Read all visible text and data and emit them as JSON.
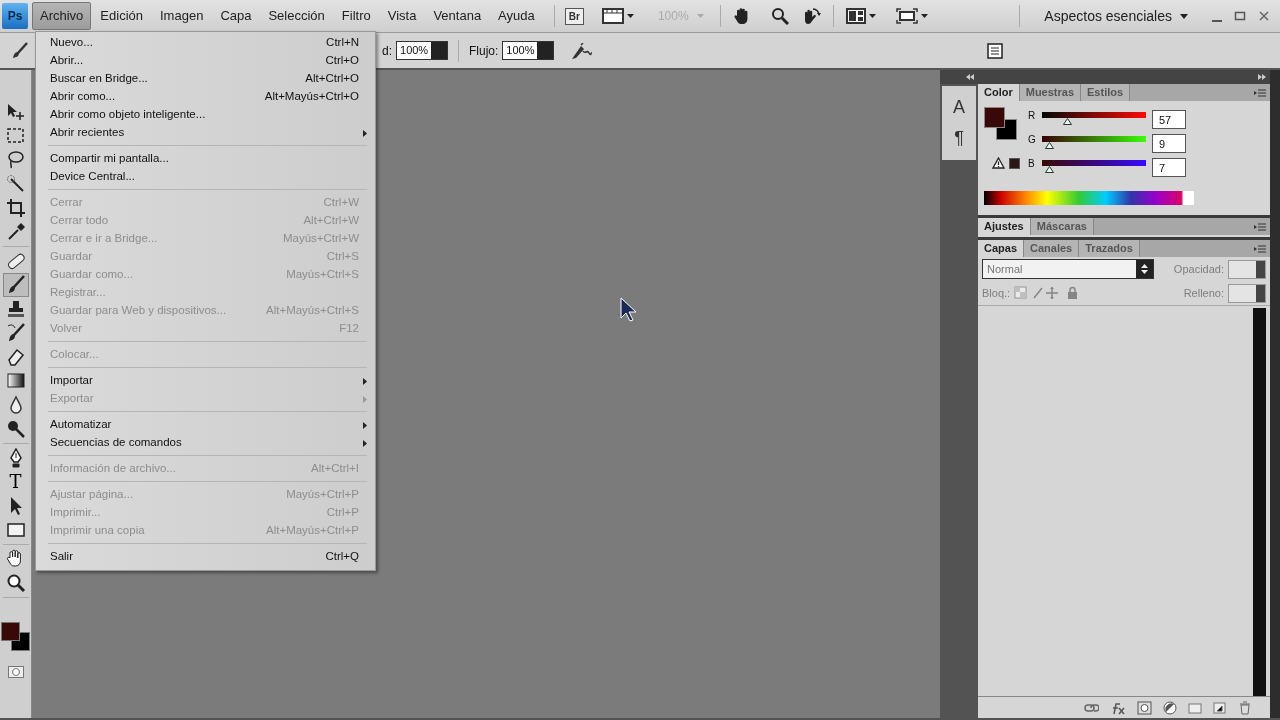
{
  "app_logo": "Ps",
  "menubar": {
    "menus": [
      {
        "label": "Archivo",
        "selected": true
      },
      {
        "label": "Edición",
        "selected": false
      },
      {
        "label": "Imagen",
        "selected": false
      },
      {
        "label": "Capa",
        "selected": false
      },
      {
        "label": "Selección",
        "selected": false
      },
      {
        "label": "Filtro",
        "selected": false
      },
      {
        "label": "Vista",
        "selected": false
      },
      {
        "label": "Ventana",
        "selected": false
      },
      {
        "label": "Ayuda",
        "selected": false
      }
    ],
    "bridge_label": "Br",
    "zoom": {
      "value": "100%",
      "disabled": true
    },
    "workspace": "Aspectos esenciales"
  },
  "options_bar": {
    "opacity_label": "d:",
    "opacity": "100%",
    "flow_label": "Flujo:",
    "flow": "100%"
  },
  "file_menu": {
    "items": [
      {
        "kind": "item",
        "label": "Nuevo...",
        "shortcut": "Ctrl+N",
        "disabled": false,
        "submenu": false
      },
      {
        "kind": "item",
        "label": "Abrir...",
        "shortcut": "Ctrl+O",
        "disabled": false,
        "submenu": false
      },
      {
        "kind": "item",
        "label": "Buscar en Bridge...",
        "shortcut": "Alt+Ctrl+O",
        "disabled": false,
        "submenu": false
      },
      {
        "kind": "item",
        "label": "Abrir como...",
        "shortcut": "Alt+Mayús+Ctrl+O",
        "disabled": false,
        "submenu": false
      },
      {
        "kind": "item",
        "label": "Abrir como objeto inteligente...",
        "disabled": false,
        "submenu": false
      },
      {
        "kind": "item",
        "label": "Abrir recientes",
        "disabled": false,
        "submenu": true
      },
      {
        "kind": "separator"
      },
      {
        "kind": "item",
        "label": "Compartir mi pantalla...",
        "disabled": false,
        "submenu": false
      },
      {
        "kind": "item",
        "label": "Device Central...",
        "disabled": false,
        "submenu": false
      },
      {
        "kind": "separator"
      },
      {
        "kind": "item",
        "label": "Cerrar",
        "shortcut": "Ctrl+W",
        "disabled": true,
        "submenu": false
      },
      {
        "kind": "item",
        "label": "Cerrar todo",
        "shortcut": "Alt+Ctrl+W",
        "disabled": true,
        "submenu": false
      },
      {
        "kind": "item",
        "label": "Cerrar e ir a Bridge...",
        "shortcut": "Mayús+Ctrl+W",
        "disabled": true,
        "submenu": false
      },
      {
        "kind": "item",
        "label": "Guardar",
        "shortcut": "Ctrl+S",
        "disabled": true,
        "submenu": false
      },
      {
        "kind": "item",
        "label": "Guardar como...",
        "shortcut": "Mayús+Ctrl+S",
        "disabled": true,
        "submenu": false
      },
      {
        "kind": "item",
        "label": "Registrar...",
        "disabled": true,
        "submenu": false
      },
      {
        "kind": "item",
        "label": "Guardar para Web y dispositivos...",
        "shortcut": "Alt+Mayús+Ctrl+S",
        "disabled": true,
        "submenu": false
      },
      {
        "kind": "item",
        "label": "Volver",
        "shortcut": "F12",
        "disabled": true,
        "submenu": false
      },
      {
        "kind": "separator"
      },
      {
        "kind": "item",
        "label": "Colocar...",
        "disabled": true,
        "submenu": false
      },
      {
        "kind": "separator"
      },
      {
        "kind": "item",
        "label": "Importar",
        "disabled": false,
        "submenu": true
      },
      {
        "kind": "item",
        "label": "Exportar",
        "disabled": true,
        "submenu": true
      },
      {
        "kind": "separator"
      },
      {
        "kind": "item",
        "label": "Automatizar",
        "disabled": false,
        "submenu": true
      },
      {
        "kind": "item",
        "label": "Secuencias de comandos",
        "disabled": false,
        "submenu": true
      },
      {
        "kind": "separator"
      },
      {
        "kind": "item",
        "label": "Información de archivo...",
        "shortcut": "Alt+Ctrl+I",
        "disabled": true,
        "submenu": false
      },
      {
        "kind": "separator"
      },
      {
        "kind": "item",
        "label": "Ajustar página...",
        "shortcut": "Mayús+Ctrl+P",
        "disabled": true,
        "submenu": false
      },
      {
        "kind": "item",
        "label": "Imprimir...",
        "shortcut": "Ctrl+P",
        "disabled": true,
        "submenu": false
      },
      {
        "kind": "item",
        "label": "Imprimir una copia",
        "shortcut": "Alt+Mayús+Ctrl+P",
        "disabled": true,
        "submenu": false
      },
      {
        "kind": "separator"
      },
      {
        "kind": "item",
        "label": "Salir",
        "shortcut": "Ctrl+Q",
        "disabled": false,
        "submenu": false
      }
    ]
  },
  "toolbox": {
    "tool_groups": [
      {
        "tools": [
          {
            "kind": "move",
            "selected": false
          },
          {
            "kind": "marquee",
            "selected": false
          },
          {
            "kind": "lasso",
            "selected": false
          },
          {
            "kind": "wand",
            "selected": false
          },
          {
            "kind": "crop",
            "selected": false
          },
          {
            "kind": "eyedropper",
            "selected": false
          }
        ]
      },
      {
        "tools": [
          {
            "kind": "bandage",
            "selected": false
          },
          {
            "kind": "brush",
            "selected": true
          },
          {
            "kind": "stamp",
            "selected": false
          },
          {
            "kind": "history",
            "selected": false
          },
          {
            "kind": "eraser",
            "selected": false
          },
          {
            "kind": "gradient",
            "selected": false
          },
          {
            "kind": "drop",
            "selected": false
          },
          {
            "kind": "dodge",
            "selected": false
          }
        ]
      },
      {
        "tools": [
          {
            "kind": "pen",
            "selected": false
          },
          {
            "kind": "type",
            "glyph": "T",
            "selected": false
          },
          {
            "kind": "pointer",
            "selected": false
          },
          {
            "kind": "rectangle",
            "selected": false
          }
        ]
      },
      {
        "tools": [
          {
            "kind": "hand",
            "selected": false
          },
          {
            "kind": "zoom",
            "selected": false
          }
        ]
      }
    ]
  },
  "dock": {
    "buttons": [
      {
        "glyph": "A"
      },
      {
        "glyph": "¶"
      }
    ]
  },
  "color_panel": {
    "tabs": [
      {
        "label": "Color",
        "selected": true
      },
      {
        "label": "Muestras",
        "selected": false
      },
      {
        "label": "Estilos",
        "selected": false
      }
    ],
    "channels": [
      {
        "label": "R",
        "value": "57",
        "level": 0.22
      },
      {
        "label": "G",
        "value": "9",
        "level": 0.035
      },
      {
        "label": "B",
        "value": "7",
        "level": 0.027
      }
    ]
  },
  "adjustments_panel": {
    "tabs": [
      {
        "label": "Ajustes",
        "selected": true
      },
      {
        "label": "Máscaras",
        "selected": false
      }
    ]
  },
  "layers_panel": {
    "tabs": [
      {
        "label": "Capas",
        "selected": true
      },
      {
        "label": "Canales",
        "selected": false
      },
      {
        "label": "Trazados",
        "selected": false
      }
    ],
    "blend_mode": "Normal",
    "opacity_label": "Opacidad:",
    "lock_label": "Bloq.:",
    "fill_label": "Relleno:",
    "disabled": true
  }
}
